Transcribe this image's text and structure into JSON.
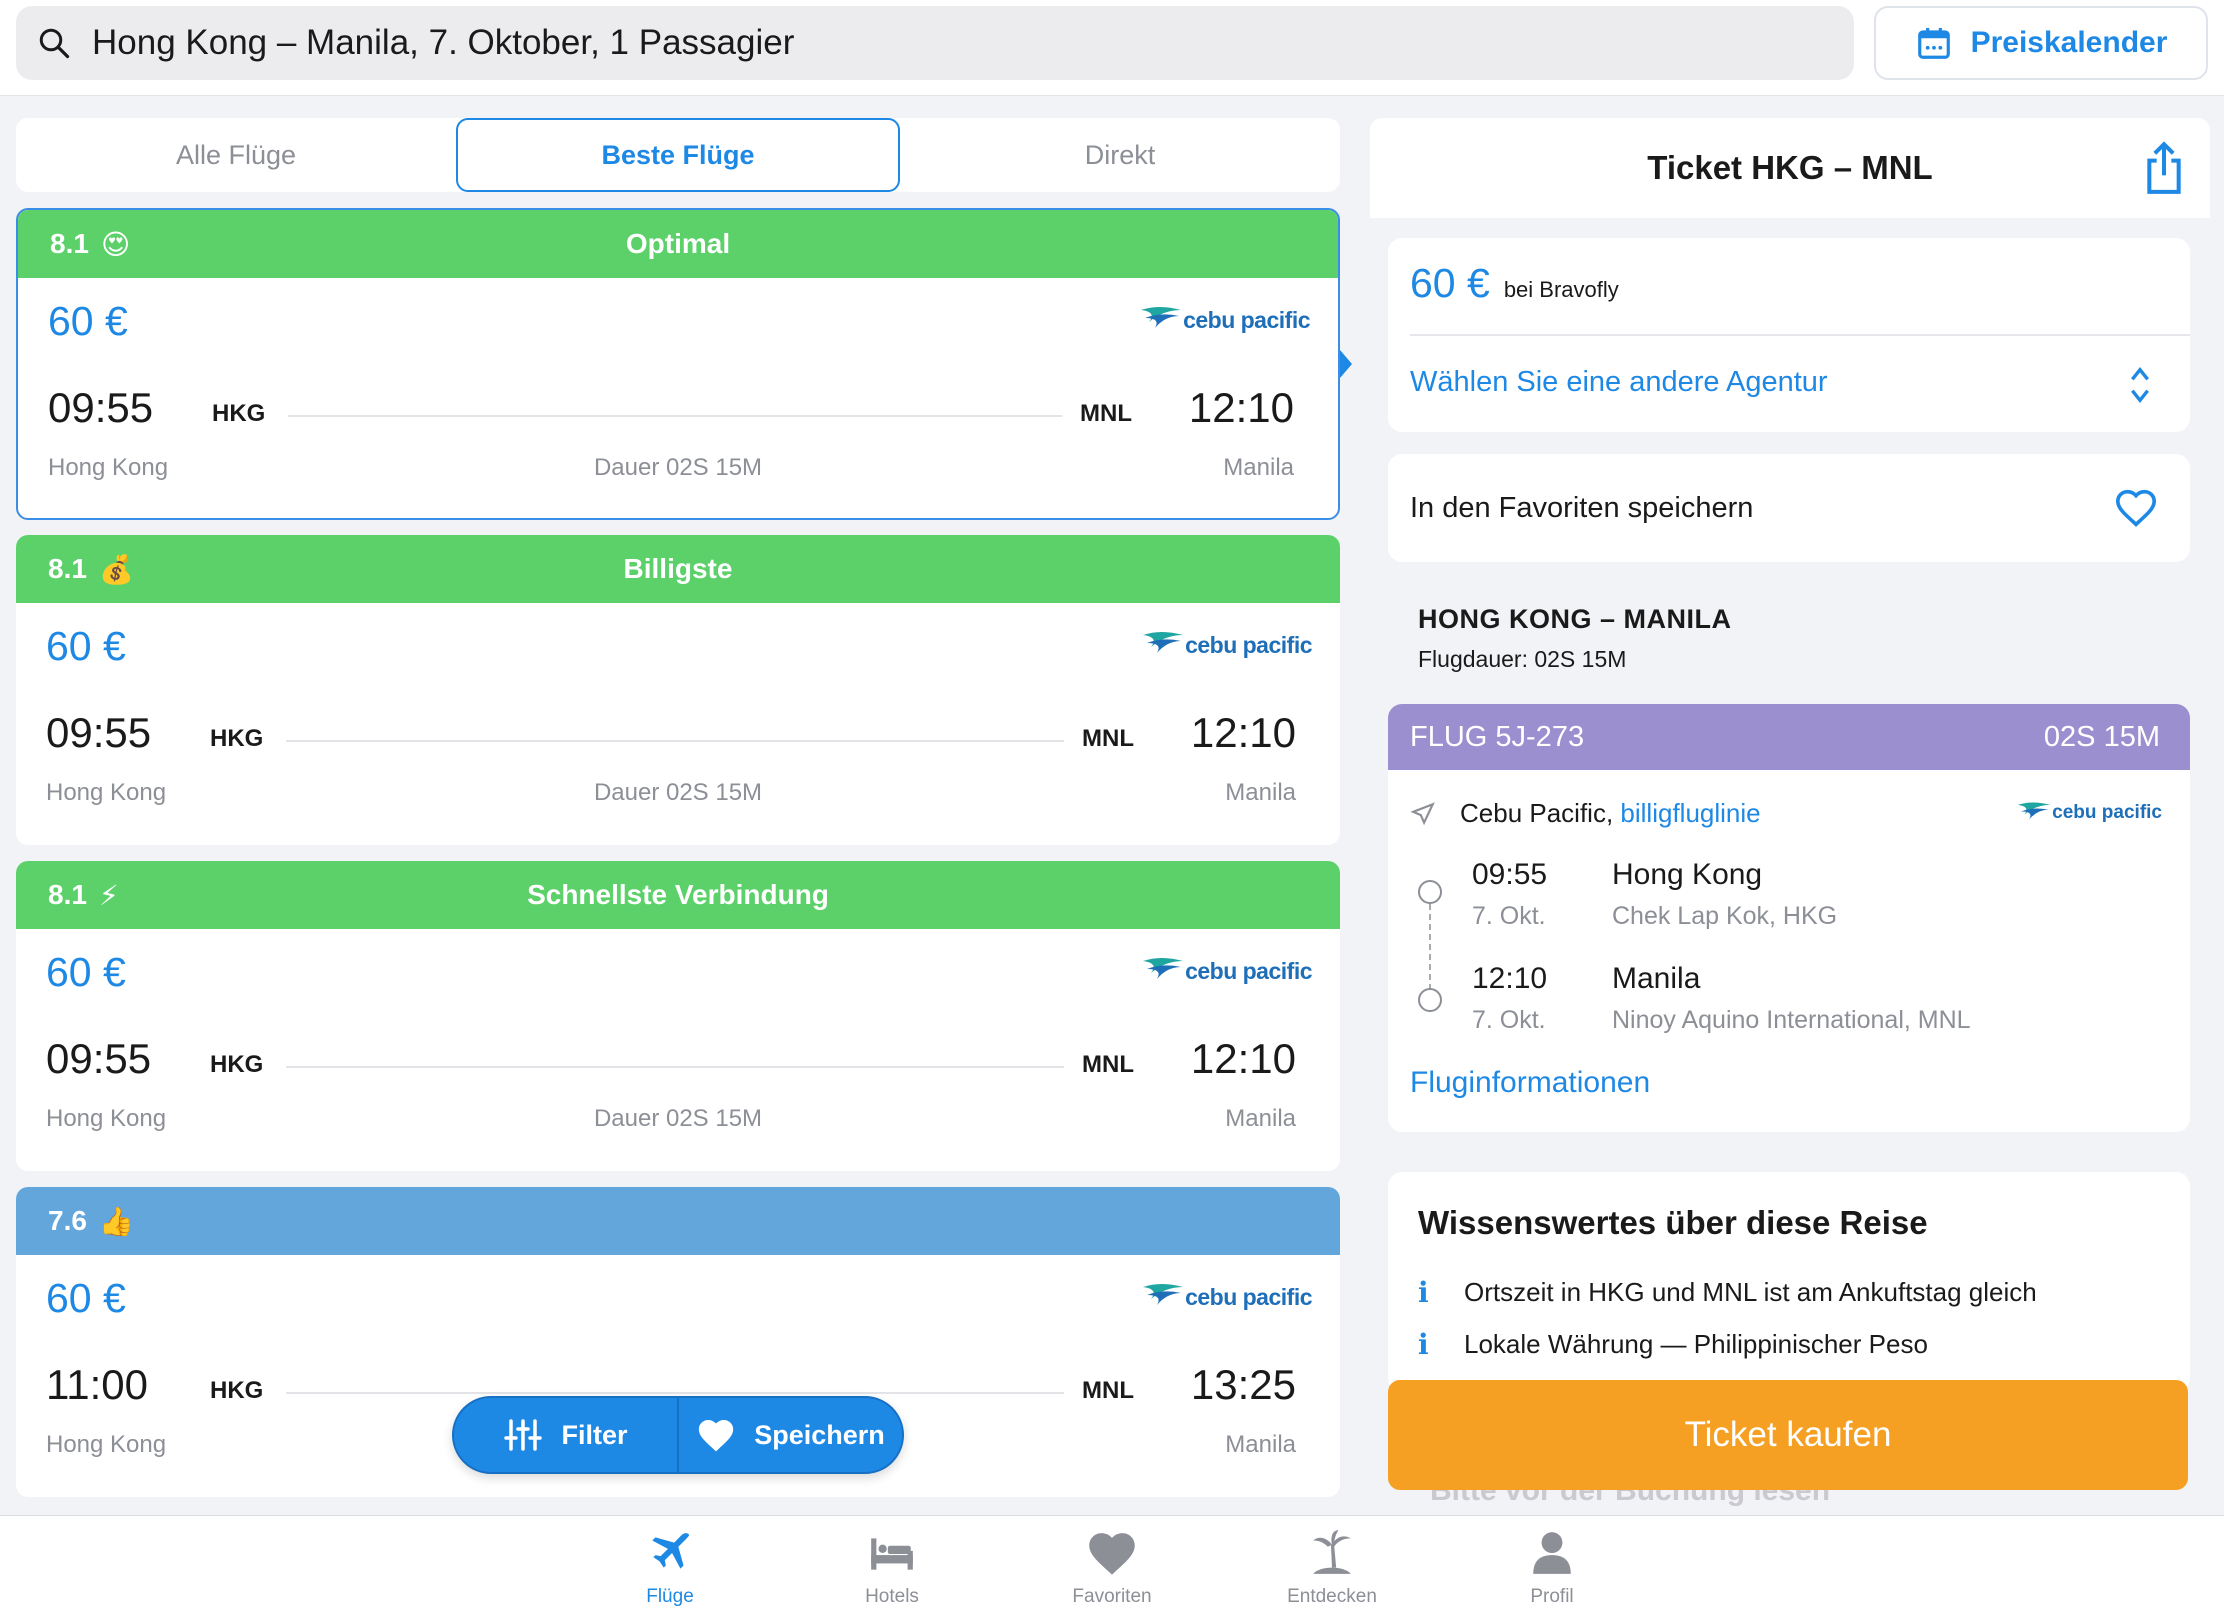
{
  "search": {
    "query": "Hong Kong – Manila, 7. Oktober, 1 Passagier",
    "price_calendar_label": "Preiskalender"
  },
  "tabs": [
    {
      "label": "Alle Flüge",
      "active": false
    },
    {
      "label": "Beste Flüge",
      "active": true
    },
    {
      "label": "Direkt",
      "active": false
    }
  ],
  "flights": [
    {
      "score": "8.1",
      "emoji": "😍",
      "tag": "Optimal",
      "header_color": "#5cd16a",
      "price": "60 €",
      "airline": "cebu pacific",
      "dep_time": "09:55",
      "dep_code": "HKG",
      "dep_city": "Hong Kong",
      "arr_time": "12:10",
      "arr_code": "MNL",
      "arr_city": "Manila",
      "duration": "Dauer 02S 15M",
      "selected": true
    },
    {
      "score": "8.1",
      "emoji": "💰",
      "tag": "Billigste",
      "header_color": "#5cd16a",
      "price": "60 €",
      "airline": "cebu pacific",
      "dep_time": "09:55",
      "dep_code": "HKG",
      "dep_city": "Hong Kong",
      "arr_time": "12:10",
      "arr_code": "MNL",
      "arr_city": "Manila",
      "duration": "Dauer 02S 15M",
      "selected": false
    },
    {
      "score": "8.1",
      "emoji": "⚡",
      "tag": "Schnellste Verbindung",
      "header_color": "#5cd16a",
      "price": "60 €",
      "airline": "cebu pacific",
      "dep_time": "09:55",
      "dep_code": "HKG",
      "dep_city": "Hong Kong",
      "arr_time": "12:10",
      "arr_code": "MNL",
      "arr_city": "Manila",
      "duration": "Dauer 02S 15M",
      "selected": false
    },
    {
      "score": "7.6",
      "emoji": "👍",
      "tag": "",
      "header_color": "#63a6dc",
      "price": "60 €",
      "airline": "cebu pacific",
      "dep_time": "11:00",
      "dep_code": "HKG",
      "dep_city": "Hong Kong",
      "arr_time": "13:25",
      "arr_code": "MNL",
      "arr_city": "Manila",
      "duration": "",
      "selected": false
    }
  ],
  "float_buttons": {
    "filter": "Filter",
    "save": "Speichern"
  },
  "ticket": {
    "title": "Ticket HKG – MNL",
    "price": "60 €",
    "agency": "bei Bravofly",
    "choose_agency": "Wählen Sie eine andere Agentur",
    "save_favorites": "In den Favoriten speichern",
    "route_title": "HONG KONG – MANILA",
    "route_duration": "Flugdauer: 02S 15M",
    "flight": {
      "number": "FLUG 5J-273",
      "duration": "02S 15M",
      "airline": "Cebu Pacific,",
      "airline_type": "billigfluglinie",
      "airline_logo": "cebu pacific",
      "dep_time": "09:55",
      "dep_date": "7. Okt.",
      "dep_city": "Hong Kong",
      "dep_airport": "Chek Lap Kok, HKG",
      "arr_time": "12:10",
      "arr_date": "7. Okt.",
      "arr_city": "Manila",
      "arr_airport": "Ninoy Aquino International, MNL",
      "info_link": "Fluginformationen"
    },
    "info": {
      "title": "Wissenswertes über diese Reise",
      "items": [
        "Ortszeit in HKG und MNL ist am Ankuftstag gleich",
        "Lokale Währung — Philippinischer Peso"
      ]
    },
    "buy_label": "Ticket kaufen",
    "faded_text": "Bitte vor der Buchung lesen"
  },
  "tabbar": [
    {
      "label": "Flüge",
      "icon": "plane-icon",
      "active": true
    },
    {
      "label": "Hotels",
      "icon": "bed-icon",
      "active": false
    },
    {
      "label": "Favoriten",
      "icon": "heart-icon",
      "active": false
    },
    {
      "label": "Entdecken",
      "icon": "palm-island-icon",
      "active": false
    },
    {
      "label": "Profil",
      "icon": "person-icon",
      "active": false
    }
  ],
  "colors": {
    "accent": "#1e88e5",
    "green_header": "#5cd16a",
    "blue_header": "#63a6dc",
    "flight_header": "#9b8fcf",
    "buy_button": "#f5a023"
  }
}
